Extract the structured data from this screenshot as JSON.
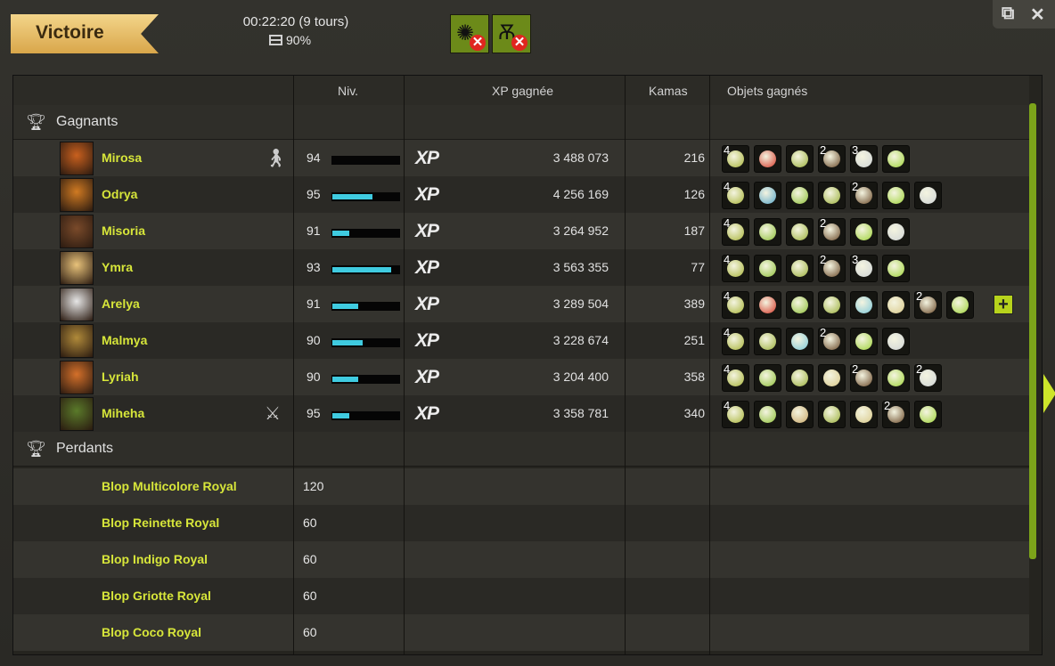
{
  "header": {
    "result": "Victoire",
    "duration": "00:22:20 (9 tours)",
    "chest_pct": "90%",
    "close_icon": "close-icon",
    "popout_icon": "popout-icon"
  },
  "columns": {
    "level": "Niv.",
    "xp": "XP gagnée",
    "kamas": "Kamas",
    "items": "Objets gagnés"
  },
  "winners": {
    "label": "Gagnants",
    "players": [
      {
        "name": "Mirosa",
        "level": "94",
        "xp_progress": 0.0,
        "xp": "3 488 073",
        "kamas": "216",
        "avatar_color": "#c9601e",
        "role": "person-icon",
        "items": [
          {
            "c": "#a8b43a",
            "q": "4"
          },
          {
            "c": "#d43a2a",
            "q": ""
          },
          {
            "c": "#9bb03c",
            "q": ""
          },
          {
            "c": "#6a4a2a",
            "q": "2"
          },
          {
            "c": "#cfd4d6",
            "q": "3"
          },
          {
            "c": "#9fd33a",
            "q": ""
          }
        ]
      },
      {
        "name": "Odrya",
        "level": "95",
        "xp_progress": 0.6,
        "xp": "4 256 169",
        "kamas": "126",
        "avatar_color": "#d07a22",
        "role": "",
        "items": [
          {
            "c": "#a8b43a",
            "q": "4"
          },
          {
            "c": "#5aa7c9",
            "q": ""
          },
          {
            "c": "#8fc03a",
            "q": ""
          },
          {
            "c": "#9bb03c",
            "q": ""
          },
          {
            "c": "#6a4a2a",
            "q": "2"
          },
          {
            "c": "#9fd33a",
            "q": ""
          },
          {
            "c": "#cfd4d6",
            "q": ""
          }
        ]
      },
      {
        "name": "Misoria",
        "level": "91",
        "xp_progress": 0.25,
        "xp": "3 264 952",
        "kamas": "187",
        "avatar_color": "#7a4a2a",
        "role": "",
        "items": [
          {
            "c": "#a8b43a",
            "q": "4"
          },
          {
            "c": "#8fc03a",
            "q": ""
          },
          {
            "c": "#9bb03c",
            "q": ""
          },
          {
            "c": "#6a4a2a",
            "q": "2"
          },
          {
            "c": "#9fd33a",
            "q": ""
          },
          {
            "c": "#cfd4d6",
            "q": ""
          }
        ]
      },
      {
        "name": "Ymra",
        "level": "93",
        "xp_progress": 0.88,
        "xp": "3 563 355",
        "kamas": "77",
        "avatar_color": "#e8c27a",
        "role": "",
        "items": [
          {
            "c": "#a8b43a",
            "q": "4"
          },
          {
            "c": "#8fc03a",
            "q": ""
          },
          {
            "c": "#9bb03c",
            "q": ""
          },
          {
            "c": "#6a4a2a",
            "q": "2"
          },
          {
            "c": "#cfd4d6",
            "q": "3"
          },
          {
            "c": "#9fd33a",
            "q": ""
          }
        ]
      },
      {
        "name": "Arelya",
        "level": "91",
        "xp_progress": 0.38,
        "xp": "3 289 504",
        "kamas": "389",
        "avatar_color": "#e6e6e6",
        "role": "",
        "items": [
          {
            "c": "#a8b43a",
            "q": "4"
          },
          {
            "c": "#d43a2a",
            "q": ""
          },
          {
            "c": "#8fc03a",
            "q": ""
          },
          {
            "c": "#9bb03c",
            "q": ""
          },
          {
            "c": "#7fc8d8",
            "q": ""
          },
          {
            "c": "#d9c98a",
            "q": ""
          },
          {
            "c": "#6a4a2a",
            "q": "2"
          },
          {
            "c": "#9fd33a",
            "q": ""
          }
        ]
      },
      {
        "name": "Malmya",
        "level": "90",
        "xp_progress": 0.45,
        "xp": "3 228 674",
        "kamas": "251",
        "avatar_color": "#b08a3a",
        "role": "",
        "items": [
          {
            "c": "#a8b43a",
            "q": "4"
          },
          {
            "c": "#9bb03c",
            "q": ""
          },
          {
            "c": "#7fc8d8",
            "q": ""
          },
          {
            "c": "#6a4a2a",
            "q": "2"
          },
          {
            "c": "#9fd33a",
            "q": ""
          },
          {
            "c": "#cfd4d6",
            "q": ""
          }
        ]
      },
      {
        "name": "Lyriah",
        "level": "90",
        "xp_progress": 0.38,
        "xp": "3 204 400",
        "kamas": "358",
        "avatar_color": "#d4702a",
        "role": "",
        "items": [
          {
            "c": "#a8b43a",
            "q": "4"
          },
          {
            "c": "#8fc03a",
            "q": ""
          },
          {
            "c": "#9bb03c",
            "q": ""
          },
          {
            "c": "#d9c98a",
            "q": ""
          },
          {
            "c": "#6a4a2a",
            "q": "2"
          },
          {
            "c": "#9fd33a",
            "q": ""
          },
          {
            "c": "#cfd4d6",
            "q": "2"
          }
        ]
      },
      {
        "name": "Miheha",
        "level": "95",
        "xp_progress": 0.25,
        "xp": "3 358 781",
        "kamas": "340",
        "avatar_color": "#5a7a2a",
        "role": "sword-icon",
        "items": [
          {
            "c": "#a8b43a",
            "q": "4"
          },
          {
            "c": "#8fc03a",
            "q": ""
          },
          {
            "c": "#c9a86a",
            "q": ""
          },
          {
            "c": "#9bb03c",
            "q": ""
          },
          {
            "c": "#d9c98a",
            "q": ""
          },
          {
            "c": "#6a4a2a",
            "q": "2"
          },
          {
            "c": "#9fd33a",
            "q": ""
          }
        ]
      }
    ]
  },
  "losers": {
    "label": "Perdants",
    "monsters": [
      {
        "name": "Blop Multicolore Royal",
        "level": "120"
      },
      {
        "name": "Blop Reinette Royal",
        "level": "60"
      },
      {
        "name": "Blop Indigo Royal",
        "level": "60"
      },
      {
        "name": "Blop Griotte Royal",
        "level": "60"
      },
      {
        "name": "Blop Coco Royal",
        "level": "60"
      }
    ]
  },
  "xp_icon_label": "XP",
  "accent": "#d7e63a"
}
